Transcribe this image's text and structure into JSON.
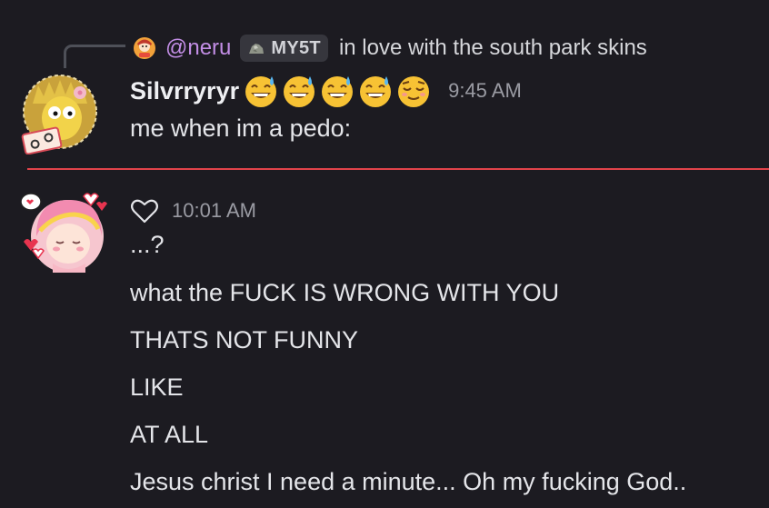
{
  "reply": {
    "username": "@neru",
    "tag": "MY5T",
    "text": "in love with the south park skins"
  },
  "message1": {
    "username": "Silvrryryr",
    "emoji_names": [
      "sweat-smile-emoji",
      "sweat-smile-emoji",
      "sweat-smile-emoji",
      "sweat-smile-emoji",
      "relieved-emoji"
    ],
    "timestamp": "9:45 AM",
    "text": "me when im a pedo:"
  },
  "message2": {
    "timestamp": "10:01 AM",
    "lines": [
      "...?",
      "what the FUCK IS WRONG WITH YOU",
      "THATS NOT FUNNY",
      "LIKE",
      "AT ALL",
      "Jesus christ I need a minute... Oh my fucking God.."
    ]
  },
  "colors": {
    "background": "#1c1b21",
    "reply_name": "#c38ee6",
    "new_divider": "#e0434a",
    "timestamp": "#9a9ba3"
  }
}
